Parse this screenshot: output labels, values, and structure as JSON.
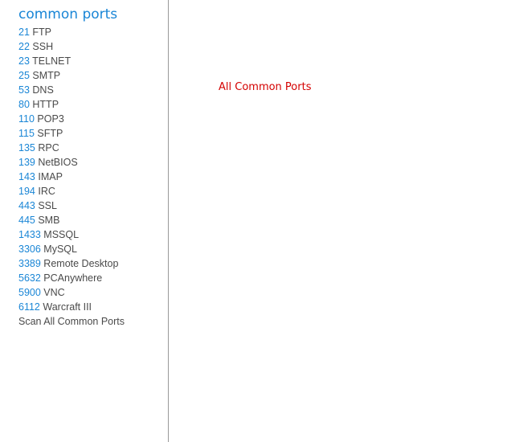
{
  "sidebar": {
    "title": "common ports",
    "ports": [
      {
        "number": "21",
        "name": "FTP"
      },
      {
        "number": "22",
        "name": "SSH"
      },
      {
        "number": "23",
        "name": "TELNET"
      },
      {
        "number": "25",
        "name": "SMTP"
      },
      {
        "number": "53",
        "name": "DNS"
      },
      {
        "number": "80",
        "name": "HTTP"
      },
      {
        "number": "110",
        "name": "POP3"
      },
      {
        "number": "115",
        "name": "SFTP"
      },
      {
        "number": "135",
        "name": "RPC"
      },
      {
        "number": "139",
        "name": "NetBIOS"
      },
      {
        "number": "143",
        "name": "IMAP"
      },
      {
        "number": "194",
        "name": "IRC"
      },
      {
        "number": "443",
        "name": "SSL"
      },
      {
        "number": "445",
        "name": "SMB"
      },
      {
        "number": "1433",
        "name": "MSSQL"
      },
      {
        "number": "3306",
        "name": "MySQL"
      },
      {
        "number": "3389",
        "name": "Remote Desktop"
      },
      {
        "number": "5632",
        "name": "PCAnywhere"
      },
      {
        "number": "5900",
        "name": "VNC"
      },
      {
        "number": "6112",
        "name": "Warcraft III"
      }
    ],
    "scan_all_label": "Scan All Common Ports"
  },
  "main": {
    "heading": "All Common Ports"
  },
  "colors": {
    "title": "#1a86d6",
    "port_number": "#1a86d6",
    "port_name": "#4a4a4a",
    "heading": "#d40000",
    "divider": "#9a9a9a"
  }
}
